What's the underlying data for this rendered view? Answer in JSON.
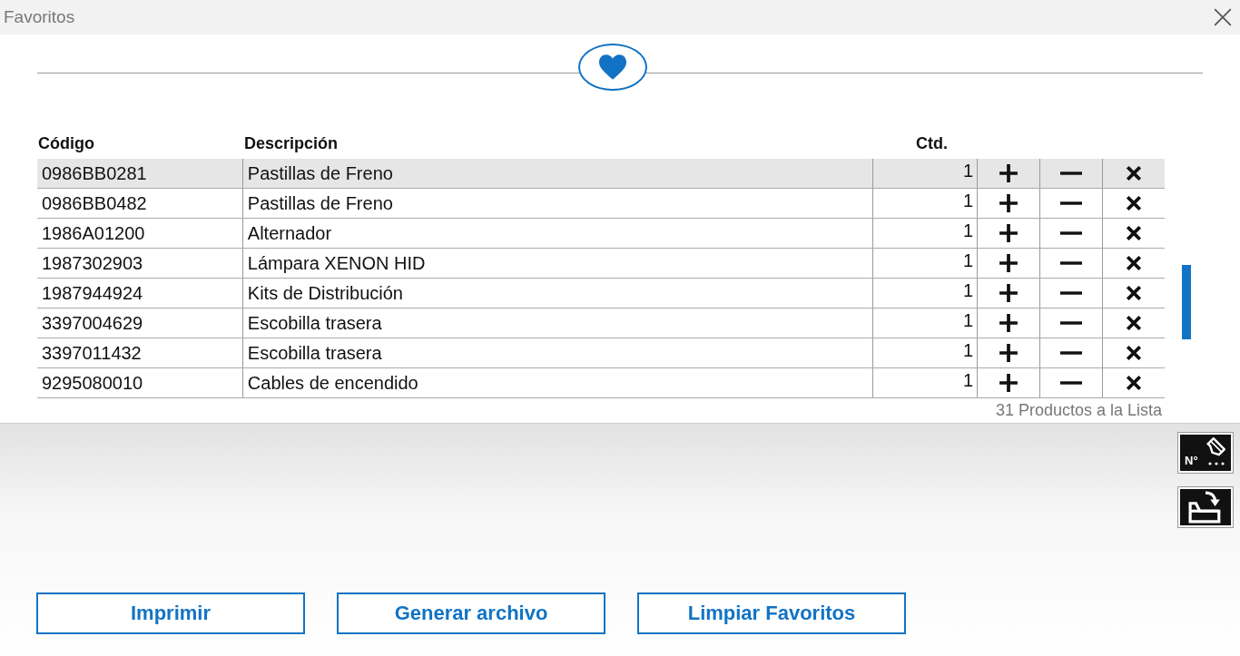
{
  "window": {
    "title": "Favoritos"
  },
  "table": {
    "columns": [
      "Código",
      "Descripción",
      "Ctd."
    ],
    "rows": [
      {
        "code": "0986BB0281",
        "description": "Pastillas de Freno",
        "qty": "1",
        "selected": true
      },
      {
        "code": "0986BB0482",
        "description": "Pastillas de Freno",
        "qty": "1",
        "selected": false
      },
      {
        "code": "1986A01200",
        "description": "Alternador",
        "qty": "1",
        "selected": false
      },
      {
        "code": "1987302903",
        "description": "Lámpara XENON HID",
        "qty": "1",
        "selected": false
      },
      {
        "code": "1987944924",
        "description": "Kits de Distribución",
        "qty": "1",
        "selected": false
      },
      {
        "code": "3397004629",
        "description": "Escobilla trasera",
        "qty": "1",
        "selected": false
      },
      {
        "code": "3397011432",
        "description": "Escobilla trasera",
        "qty": "1",
        "selected": false
      },
      {
        "code": "9295080010",
        "description": "Cables de encendido",
        "qty": "1",
        "selected": false
      }
    ],
    "count": "31 Productos a la Lista"
  },
  "side_tools": {
    "number_label": "N°"
  },
  "buttons": [
    "Imprimir",
    "Generar archivo",
    "Limpiar Favoritos"
  ]
}
